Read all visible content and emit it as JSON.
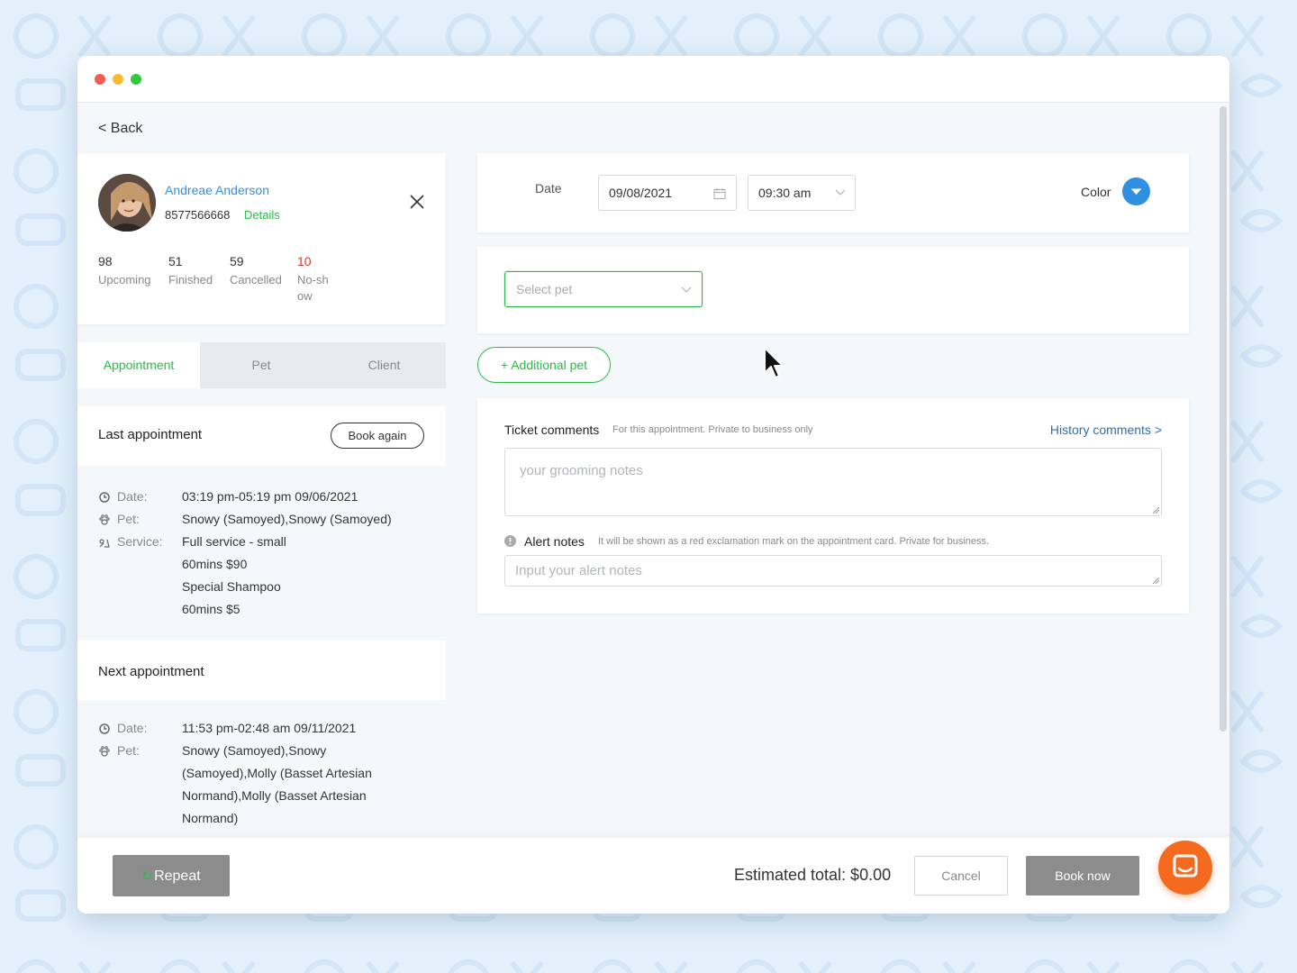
{
  "window": {
    "back_label": "< Back"
  },
  "client": {
    "name": "Andreae Anderson",
    "phone": "8577566668",
    "details_label": "Details",
    "stats": [
      {
        "value": "98",
        "label": "Upcoming"
      },
      {
        "value": "51",
        "label": "Finished"
      },
      {
        "value": "59",
        "label": "Cancelled"
      },
      {
        "value": "10",
        "label": "No-show"
      }
    ]
  },
  "tabs": [
    {
      "label": "Appointment",
      "active": true
    },
    {
      "label": "Pet",
      "active": false
    },
    {
      "label": "Client",
      "active": false
    }
  ],
  "last_appointment": {
    "title": "Last appointment",
    "book_again_label": "Book again",
    "date_key": "Date:",
    "date_value": "03:19 pm-05:19 pm 09/06/2021",
    "pet_key": "Pet:",
    "pet_value": "Snowy (Samoyed),Snowy (Samoyed)",
    "service_key": "Service:",
    "service_lines": [
      "Full service - small",
      "60mins  $90",
      "Special Shampoo",
      "60mins  $5"
    ]
  },
  "next_appointment": {
    "title": "Next appointment",
    "date_key": "Date:",
    "date_value": "11:53 pm-02:48 am 09/11/2021",
    "pet_key": "Pet:",
    "pet_lines": [
      "Snowy (Samoyed),Snowy",
      "(Samoyed),Molly (Basset Artesian",
      "Normand),Molly (Basset Artesian",
      "Normand)"
    ]
  },
  "booking": {
    "date_label": "Date",
    "date_value": "09/08/2021",
    "time_value": "09:30 am",
    "color_label": "Color",
    "color_value": "#2f8fe0",
    "select_pet_placeholder": "Select pet",
    "additional_pet_label": "+ Additional pet",
    "ticket_comments_label": "Ticket comments",
    "ticket_comments_sub": "For this appointment. Private to business only",
    "history_comments_label": "History comments >",
    "grooming_notes_placeholder": "your grooming notes",
    "alert_notes_label": "Alert notes",
    "alert_notes_sub": "It will be shown as a red exclamation mark on the appointment card. Private for business.",
    "alert_notes_placeholder": "Input your alert notes"
  },
  "footer": {
    "repeat_label": "Repeat",
    "estimated_total": "Estimated total: $0.00",
    "cancel_label": "Cancel",
    "book_now_label": "Book now"
  },
  "colors": {
    "accent_green": "#2cb84a",
    "link_blue": "#3a8dd8",
    "noshow_red": "#d23a2c",
    "chat_orange": "#f46a1e"
  },
  "icons": [
    "calendar-icon",
    "chevron-down-icon",
    "close-icon",
    "clock-icon",
    "paw-icon",
    "service-icon",
    "alert-icon",
    "repeat-icon",
    "chat-icon",
    "mouse-cursor-icon"
  ]
}
